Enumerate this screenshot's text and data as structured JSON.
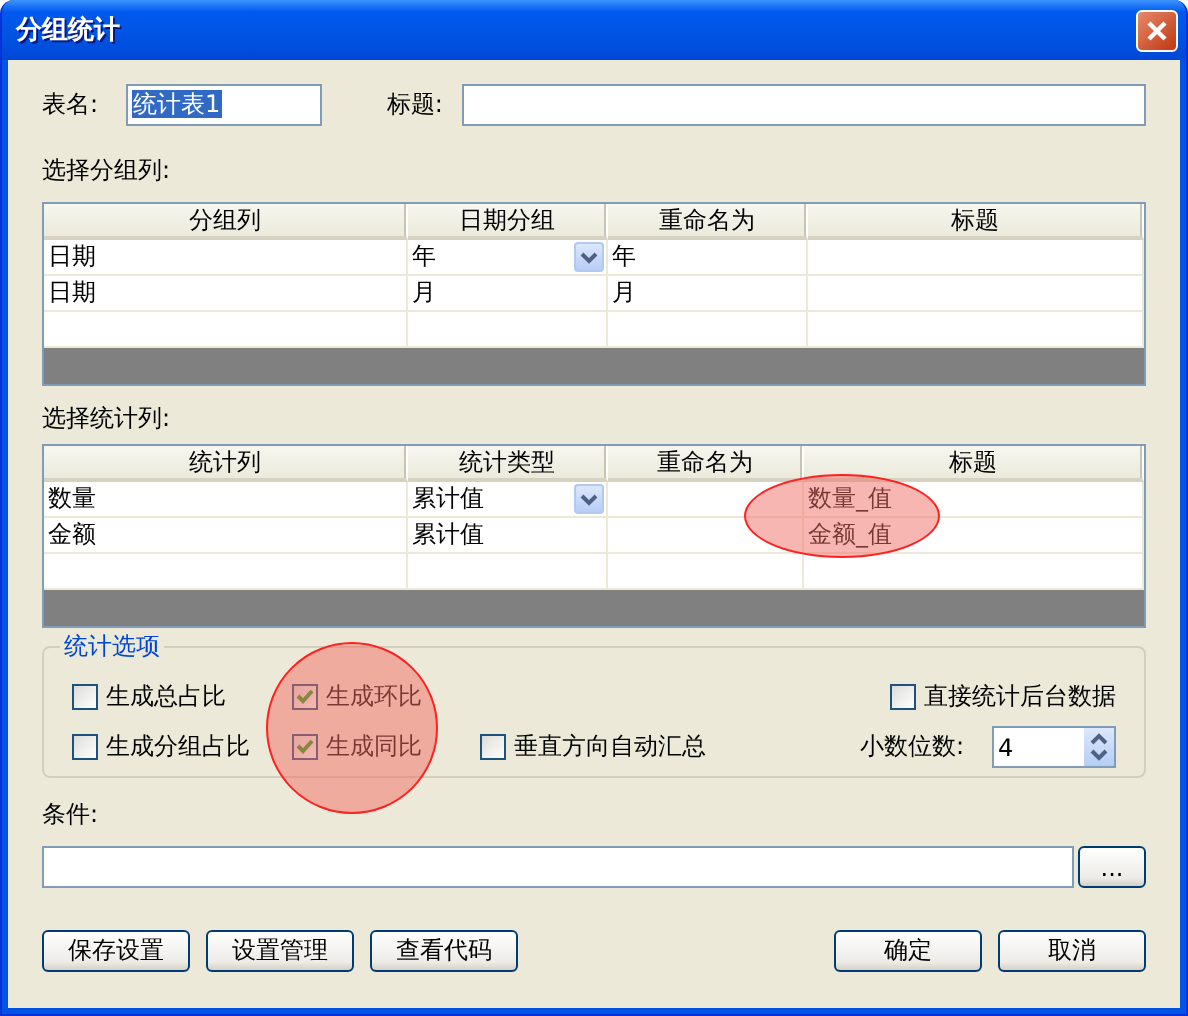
{
  "window": {
    "title": "分组统计"
  },
  "table_name": {
    "label": "表名:",
    "value": "统计表1",
    "text_selected": true
  },
  "title_field": {
    "label": "标题:"
  },
  "group_columns": {
    "label": "选择分组列:",
    "columns": [
      "分组列",
      "日期分组",
      "重命名为",
      "标题"
    ],
    "rows": [
      {
        "column": "日期",
        "date_group": "年",
        "rename": "年",
        "editing": true
      },
      {
        "column": "日期",
        "date_group": "月",
        "rename": "月",
        "editing": false
      }
    ]
  },
  "stat_columns": {
    "label": "选择统计列:",
    "columns": [
      "统计列",
      "统计类型",
      "重命名为",
      "标题"
    ],
    "rows": [
      {
        "column": "数量",
        "type": "累计值",
        "title": "数量_值",
        "editing": true
      },
      {
        "column": "金额",
        "type": "累计值",
        "title": "金额_值",
        "editing": false
      }
    ]
  },
  "options": {
    "title": "统计选项",
    "checkboxes": [
      {
        "label": "生成总占比",
        "checked": false
      },
      {
        "label": "生成环比",
        "checked": true
      },
      {
        "label": "直接统计后台数据",
        "checked": false
      },
      {
        "label": "生成分组占比",
        "checked": false
      },
      {
        "label": "生成同比",
        "checked": true
      },
      {
        "label": "垂直方向自动汇总",
        "checked": false
      }
    ],
    "decimal_places": {
      "label": "小数位数:",
      "value": "4"
    }
  },
  "condition": {
    "label": "条件:",
    "button": "..."
  },
  "buttons_left": [
    "保存设置",
    "设置管理",
    "查看代码"
  ],
  "buttons_right": [
    "确定",
    "取消"
  ],
  "annotations": [
    {
      "kind": "ellipse"
    },
    {
      "kind": "circle"
    }
  ]
}
